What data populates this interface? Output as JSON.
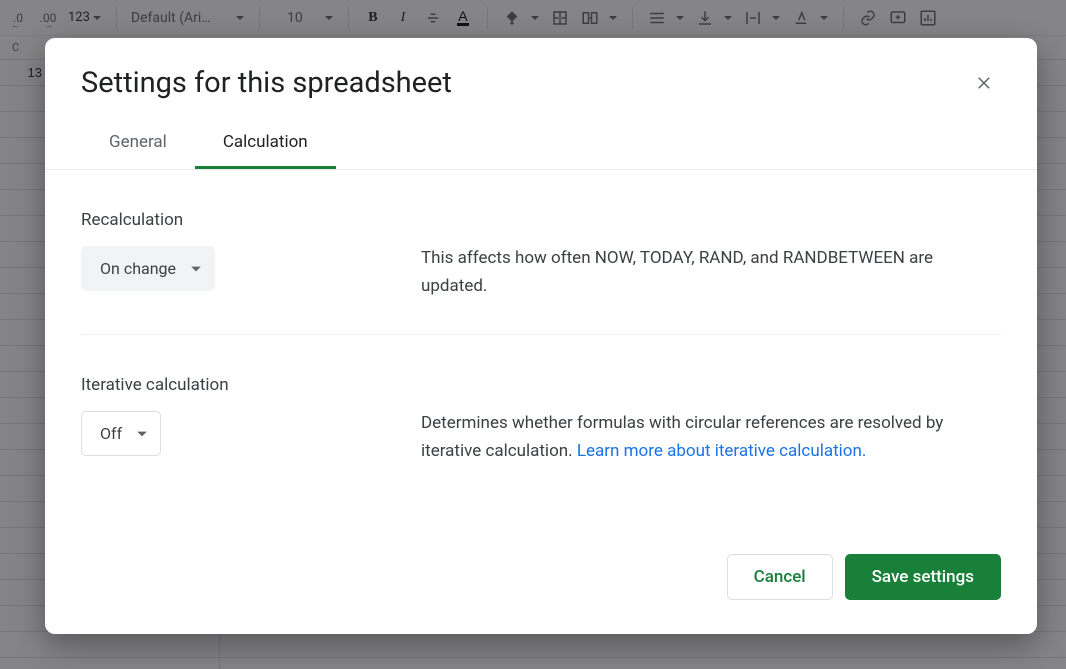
{
  "toolbar": {
    "remove_decimal_label": ".0",
    "add_decimal_label": ".00",
    "format_number_label": "123",
    "font_name": "Default (Ari…",
    "font_size": "10"
  },
  "sheet": {
    "col_label": "C",
    "cell_value": "13"
  },
  "dialog": {
    "title": "Settings for this spreadsheet",
    "tabs": {
      "general": "General",
      "calculation": "Calculation"
    },
    "recalculation": {
      "label": "Recalculation",
      "value": "On change",
      "description": "This affects how often NOW, TODAY, RAND, and RANDBETWEEN are updated."
    },
    "iterative": {
      "label": "Iterative calculation",
      "value": "Off",
      "description_prefix": "Determines whether formulas with circular references are resolved by iterative calculation. ",
      "learn_more": "Learn more about iterative calculation."
    },
    "buttons": {
      "cancel": "Cancel",
      "save": "Save settings"
    }
  }
}
